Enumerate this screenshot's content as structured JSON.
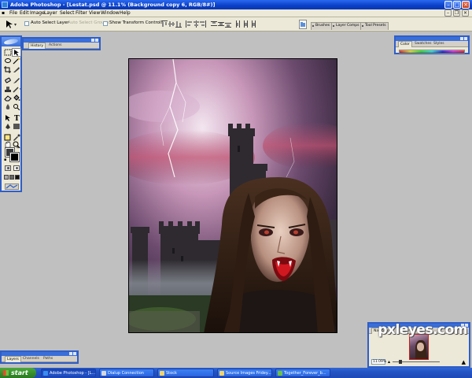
{
  "window": {
    "title": "Adobe Photoshop - [Lestat.psd @ 11.1% (Background copy 6, RGB/8#)]"
  },
  "menu": [
    "File",
    "Edit",
    "Image",
    "Layer",
    "Select",
    "Filter",
    "View",
    "Window",
    "Help"
  ],
  "options_bar": {
    "auto_select_layer": "Auto Select Layer",
    "auto_select_groups": "Auto Select Groups",
    "show_transform_controls": "Show Transform Controls"
  },
  "palette_well": [
    "Brushes",
    "Layer Comps",
    "Tool Presets"
  ],
  "panels": {
    "history": {
      "tabs": [
        "History",
        "Actions"
      ]
    },
    "color": {
      "tabs": [
        "Color",
        "Swatches",
        "Styles"
      ]
    },
    "navigator": {
      "tabs": [
        "Navigator",
        "Info",
        "Histogram"
      ],
      "zoom": "11.09%"
    },
    "layers": {
      "tabs": [
        "Layers",
        "Channels",
        "Paths"
      ]
    }
  },
  "watermark": "pxleyes.com",
  "taskbar": {
    "start": "start",
    "tasks": [
      {
        "label": "Adobe Photoshop - [L...",
        "color": "#3a8cf0"
      },
      {
        "label": "Dialup Connection",
        "color": "#d8d8d8"
      },
      {
        "label": "Stock",
        "color": "#f2d36a"
      },
      {
        "label": "Source Images Fridey...",
        "color": "#f2d36a"
      },
      {
        "label": "Together_Forever_b...",
        "color": "#6fc140"
      }
    ]
  },
  "colors": {
    "titlebar": "#0a3fc8",
    "panel_border": "#2f5ec8",
    "workspace": "#c0c0c0",
    "taskbar": "#2454c5",
    "start_green": "#348c2a"
  }
}
